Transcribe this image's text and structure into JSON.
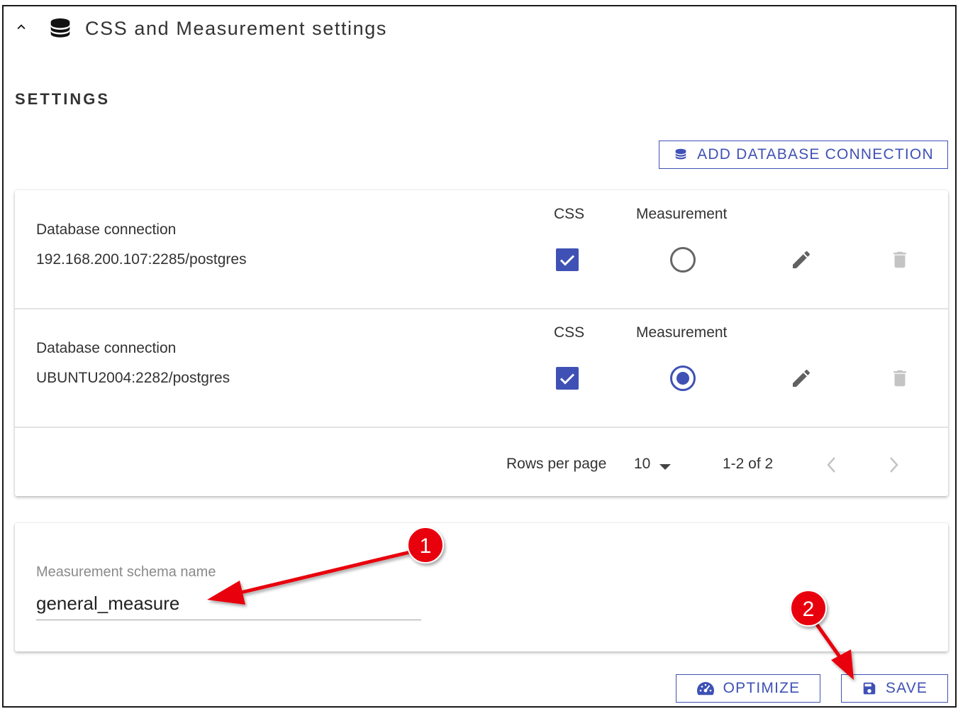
{
  "panel": {
    "title": "CSS and Measurement settings",
    "section_title": "SETTINGS",
    "add_button_label": "ADD DATABASE CONNECTION"
  },
  "table": {
    "headers": {
      "css": "CSS",
      "measurement": "Measurement"
    },
    "rows": [
      {
        "label": "Database connection",
        "value": "192.168.200.107:2285/postgres",
        "css_checked": true,
        "measurement_selected": false
      },
      {
        "label": "Database connection",
        "value": "UBUNTU2004:2282/postgres",
        "css_checked": true,
        "measurement_selected": true
      }
    ],
    "pagination": {
      "rows_per_page_label": "Rows per page",
      "rows_per_page_value": "10",
      "range": "1-2 of 2"
    }
  },
  "schema": {
    "label": "Measurement schema name",
    "value": "general_measure"
  },
  "actions": {
    "optimize_label": "OPTIMIZE",
    "save_label": "SAVE"
  },
  "annotations": {
    "badge1": "1",
    "badge2": "2"
  },
  "colors": {
    "accent": "#3f51b5",
    "annotation": "#e8000b",
    "icon_gray": "#616161",
    "disabled": "#c4c4c4"
  }
}
